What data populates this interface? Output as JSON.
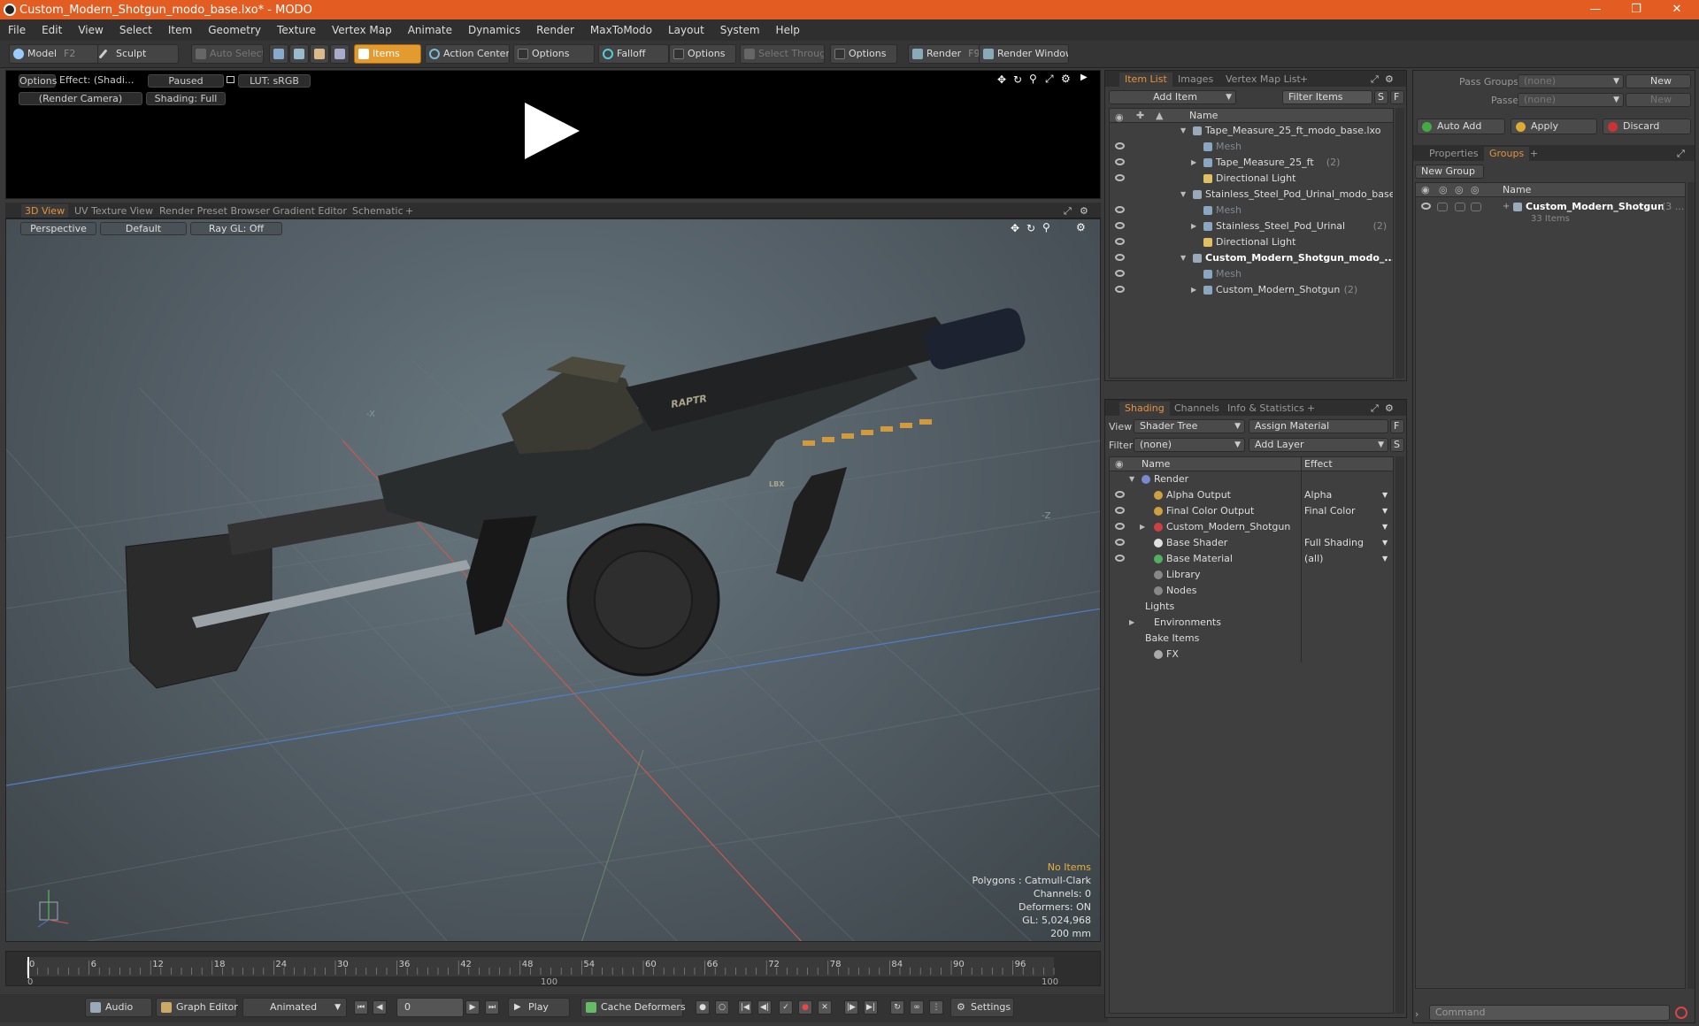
{
  "window": {
    "title": "Custom_Modern_Shotgun_modo_base.lxo* - MODO"
  },
  "menu": [
    "File",
    "Edit",
    "View",
    "Select",
    "Item",
    "Geometry",
    "Texture",
    "Vertex Map",
    "Animate",
    "Dynamics",
    "Render",
    "MaxToModo",
    "Layout",
    "System",
    "Help"
  ],
  "toolbar": {
    "model": "Model",
    "model_key": "F2",
    "sculpt": "Sculpt",
    "auto_select": "Auto Select",
    "items": "Items",
    "action_center": "Action Center",
    "options1": "Options",
    "falloff": "Falloff",
    "options2": "Options",
    "select_through": "Select Through",
    "options3": "Options",
    "render": "Render",
    "render_key": "F9",
    "render_window": "Render Window"
  },
  "preview": {
    "options": "Options",
    "effect": "Effect: (Shadi...",
    "paused": "Paused",
    "lut": "LUT: sRGB",
    "camera": "(Render Camera)",
    "shading": "Shading: Full"
  },
  "viewport_tabs": [
    "3D View",
    "UV Texture View",
    "Render Preset Browser",
    "Gradient Editor",
    "Schematic"
  ],
  "viewport": {
    "projection": "Perspective",
    "style": "Default",
    "raygl": "Ray GL: Off",
    "stats": {
      "items": "No Items",
      "polygons": "Polygons : Catmull-Clark",
      "channels": "Channels: 0",
      "deformers": "Deformers: ON",
      "gl": "GL: 5,024,968",
      "scale": "200 mm"
    },
    "decal_text": "RAPTR",
    "decal_text2": "LBX",
    "axis_marks": [
      "-X",
      "-Z"
    ]
  },
  "timeline": {
    "ticks": [
      "0",
      "6",
      "12",
      "18",
      "24",
      "30",
      "36",
      "42",
      "48",
      "54",
      "60",
      "66",
      "72",
      "78",
      "84",
      "90",
      "96"
    ],
    "lower": [
      "0",
      "100",
      "100"
    ]
  },
  "bottom": {
    "audio": "Audio",
    "graph_editor": "Graph Editor",
    "animated": "Animated",
    "frame": "0",
    "play": "Play",
    "cache": "Cache Deformers",
    "settings": "Settings"
  },
  "item_list": {
    "tabs": [
      "Item List",
      "Images",
      "Vertex Map List"
    ],
    "add_item": "Add Item",
    "filter": "Filter Items",
    "name_header": "Name",
    "rows": [
      {
        "label": "Tape_Measure_25_ft_modo_base.lxo",
        "count": ""
      },
      {
        "label": "Mesh",
        "count": ""
      },
      {
        "label": "Tape_Measure_25_ft",
        "count": "(2)"
      },
      {
        "label": "Directional Light",
        "count": ""
      },
      {
        "label": "Stainless_Steel_Pod_Urinal_modo_base....",
        "count": ""
      },
      {
        "label": "Mesh",
        "count": ""
      },
      {
        "label": "Stainless_Steel_Pod_Urinal",
        "count": "(2)"
      },
      {
        "label": "Directional Light",
        "count": ""
      },
      {
        "label": "Custom_Modern_Shotgun_modo_...",
        "count": ""
      },
      {
        "label": "Mesh",
        "count": ""
      },
      {
        "label": "Custom_Modern_Shotgun",
        "count": "(2)"
      }
    ]
  },
  "shading": {
    "tabs": [
      "Shading",
      "Channels",
      "Info & Statistics"
    ],
    "view_label": "View",
    "view_value": "Shader Tree",
    "assign": "Assign Material",
    "filter_label": "Filter",
    "filter_value": "(none)",
    "add_layer": "Add Layer",
    "col_name": "Name",
    "col_effect": "Effect",
    "rows": [
      {
        "label": "Render",
        "effect": ""
      },
      {
        "label": "Alpha Output",
        "effect": "Alpha"
      },
      {
        "label": "Final Color Output",
        "effect": "Final Color"
      },
      {
        "label": "Custom_Modern_Shotgun",
        "effect": ""
      },
      {
        "label": "Base Shader",
        "effect": "Full Shading"
      },
      {
        "label": "Base Material",
        "effect": "(all)"
      },
      {
        "label": "Library",
        "effect": ""
      },
      {
        "label": "Nodes",
        "effect": ""
      },
      {
        "label": "Lights",
        "effect": ""
      },
      {
        "label": "Environments",
        "effect": ""
      },
      {
        "label": "Bake Items",
        "effect": ""
      },
      {
        "label": "FX",
        "effect": ""
      }
    ],
    "letters": {
      "f": "F",
      "s": "S"
    }
  },
  "groups": {
    "pass_groups": "Pass Groups",
    "passes": "Passes",
    "none1": "(none)",
    "none2": "(none)",
    "new1": "New",
    "new2": "New",
    "auto_add": "Auto Add",
    "apply": "Apply",
    "discard": "Discard",
    "tabs": [
      "Properties",
      "Groups"
    ],
    "new_group": "New Group",
    "name_header": "Name",
    "group_name": "Custom_Modern_Shotgun",
    "group_count": "(3 ...",
    "group_items": "33 Items",
    "command_placeholder": "Command"
  },
  "colors": {
    "accent": "#e8913a",
    "titlebar": "#e35d22"
  }
}
